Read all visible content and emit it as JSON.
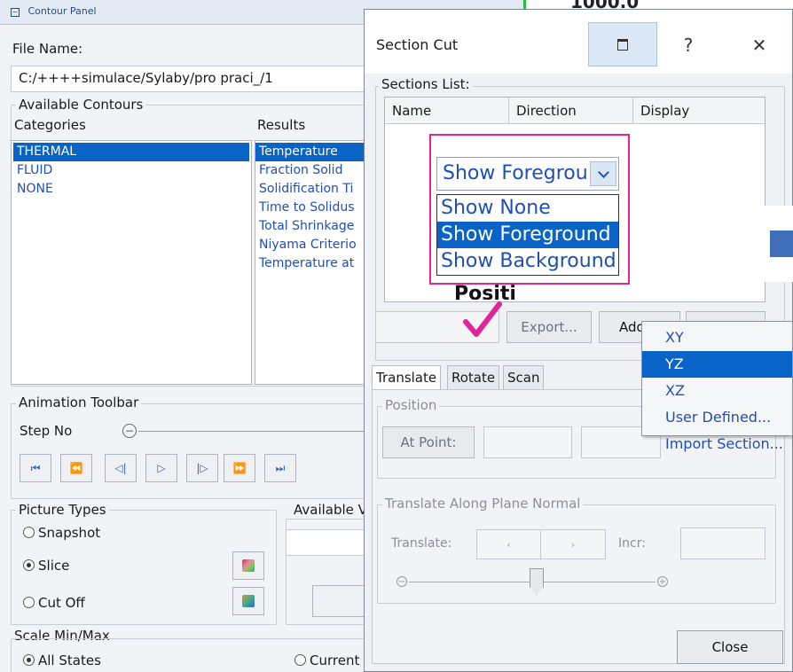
{
  "contour_panel": {
    "title": "Contour Panel",
    "file_name_label": "File Name:",
    "file_path": "C:/++++simulace/Sylaby/pro praci_/1",
    "available_contours_label": "Available Contours",
    "categories_label": "Categories",
    "results_label": "Results",
    "categories": [
      "THERMAL",
      "FLUID",
      "NONE"
    ],
    "results": [
      "Temperature",
      "Fraction Solid",
      "Solidification Ti",
      "Time to Solidus",
      "Total Shrinkage",
      "Niyama Criterio",
      "Temperature at"
    ],
    "animation_toolbar_label": "Animation Toolbar",
    "step_no_label": "Step No",
    "playback_buttons": [
      "first-frame-icon",
      "rewind-icon",
      "step-back-icon",
      "play-icon",
      "step-forward-icon",
      "fast-forward-icon",
      "last-frame-icon"
    ],
    "playback_glyphs": [
      "⏮",
      "⏪",
      "◁|",
      "▷",
      "|▷",
      "⏩",
      "⏭"
    ],
    "picture_types_label": "Picture Types",
    "picture_types": [
      "Snapshot",
      "Slice",
      "Cut Off"
    ],
    "picture_type_selected": "Slice",
    "available_v_label": "Available V",
    "scale_label": "Scale Min/Max",
    "scale_options": [
      "All States",
      "Current"
    ],
    "scale_selected": "All States",
    "right_edge_text": "1000.0"
  },
  "section_cut": {
    "title": "Section Cut",
    "help_glyph": "?",
    "close_glyph": "✕",
    "sections_list_label": "Sections List:",
    "columns": [
      "Name",
      "Direction",
      "Display"
    ],
    "display_select_value": "Show Foregrou",
    "display_options": [
      "Show None",
      "Show Foreground",
      "Show Background"
    ],
    "display_option_highlighted": "Show Foreground",
    "partial_row_text": "Positi",
    "export_label": "Export...",
    "add_label": "Add",
    "add_menu": [
      "XY",
      "YZ",
      "XZ",
      "User Defined...",
      "Import Section..."
    ],
    "add_menu_highlighted": "YZ",
    "tabs": [
      "Translate",
      "Rotate",
      "Scan"
    ],
    "active_tab": "Translate",
    "position_label": "Position",
    "at_point_label": "At Point:",
    "translate_normal_label": "Translate Along Plane Normal",
    "translate_label": "Translate:",
    "incr_label": "Incr:",
    "close_label": "Close"
  },
  "colors": {
    "accent": "#0a64c8",
    "annotation_magenta": "#e0249a",
    "link_blue": "#1f4fb5"
  }
}
